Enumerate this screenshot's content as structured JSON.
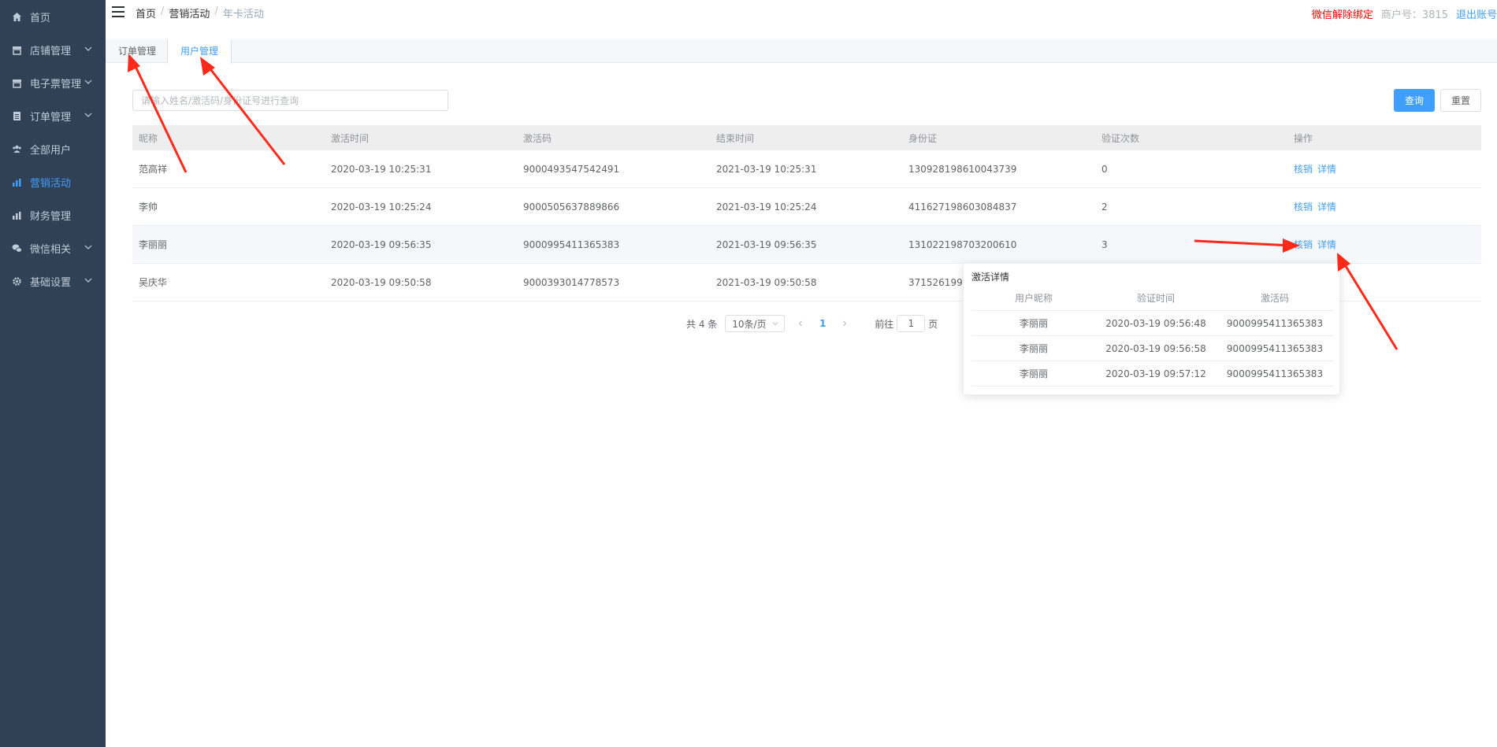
{
  "sidebar": {
    "items": [
      {
        "label": "首页",
        "icon": "home-icon",
        "has_children": false,
        "active": false
      },
      {
        "label": "店铺管理",
        "icon": "store-icon",
        "has_children": true,
        "active": false
      },
      {
        "label": "电子票管理",
        "icon": "ticket-icon",
        "has_children": true,
        "active": false
      },
      {
        "label": "订单管理",
        "icon": "order-icon",
        "has_children": true,
        "active": false
      },
      {
        "label": "全部用户",
        "icon": "users-icon",
        "has_children": false,
        "active": false
      },
      {
        "label": "营销活动",
        "icon": "chart-icon",
        "has_children": false,
        "active": true
      },
      {
        "label": "财务管理",
        "icon": "finance-icon",
        "has_children": false,
        "active": false
      },
      {
        "label": "微信相关",
        "icon": "wechat-icon",
        "has_children": true,
        "active": false
      },
      {
        "label": "基础设置",
        "icon": "gear-icon",
        "has_children": true,
        "active": false
      }
    ]
  },
  "header": {
    "breadcrumb": [
      "首页",
      "营销活动",
      "年卡活动"
    ],
    "breadcrumb_sep": "/",
    "wx_unbind": "微信解除绑定",
    "merchant": "商户号：3815",
    "logout": "退出账号"
  },
  "tabs": [
    {
      "label": "订单管理",
      "active": false
    },
    {
      "label": "用户管理",
      "active": true
    }
  ],
  "search": {
    "placeholder": "请输入姓名/激活码/身份证号进行查询",
    "query_label": "查询",
    "reset_label": "重置"
  },
  "table": {
    "columns": [
      "昵称",
      "激活时间",
      "激活码",
      "结束时间",
      "身份证",
      "验证次数",
      "操作"
    ],
    "rows": [
      {
        "name": "范高祥",
        "activated": "2020-03-19 10:25:31",
        "code": "9000493547542491",
        "end": "2021-03-19 10:25:31",
        "id": "130928198610043739",
        "count": "0"
      },
      {
        "name": "李帅",
        "activated": "2020-03-19 10:25:24",
        "code": "9000505637889866",
        "end": "2021-03-19 10:25:24",
        "id": "411627198603084837",
        "count": "2"
      },
      {
        "name": "李丽丽",
        "activated": "2020-03-19 09:56:35",
        "code": "9000995411365383",
        "end": "2021-03-19 09:56:35",
        "id": "131022198703200610",
        "count": "3"
      },
      {
        "name": "吴庆华",
        "activated": "2020-03-19 09:50:58",
        "code": "9000393014778573",
        "end": "2021-03-19 09:50:58",
        "id": "3715261994",
        "count": ""
      }
    ],
    "op_verify": "核销",
    "op_detail": "详情"
  },
  "pagination": {
    "total": "共 4 条",
    "page_size": "10条/页",
    "current": "1",
    "goto_prefix": "前往",
    "goto_value": "1",
    "goto_suffix": "页"
  },
  "popover": {
    "title": "激活详情",
    "columns": [
      "用户昵称",
      "验证时间",
      "激活码"
    ],
    "rows": [
      {
        "user": "李丽丽",
        "time": "2020-03-19 09:56:48",
        "code": "9000995411365383"
      },
      {
        "user": "李丽丽",
        "time": "2020-03-19 09:56:58",
        "code": "9000995411365383"
      },
      {
        "user": "李丽丽",
        "time": "2020-03-19 09:57:12",
        "code": "9000995411365383"
      }
    ]
  },
  "colors": {
    "sidebar_bg": "#304156",
    "accent": "#409eff",
    "warning": "#ff0000",
    "annotation_arrow": "#ff2a1a"
  }
}
